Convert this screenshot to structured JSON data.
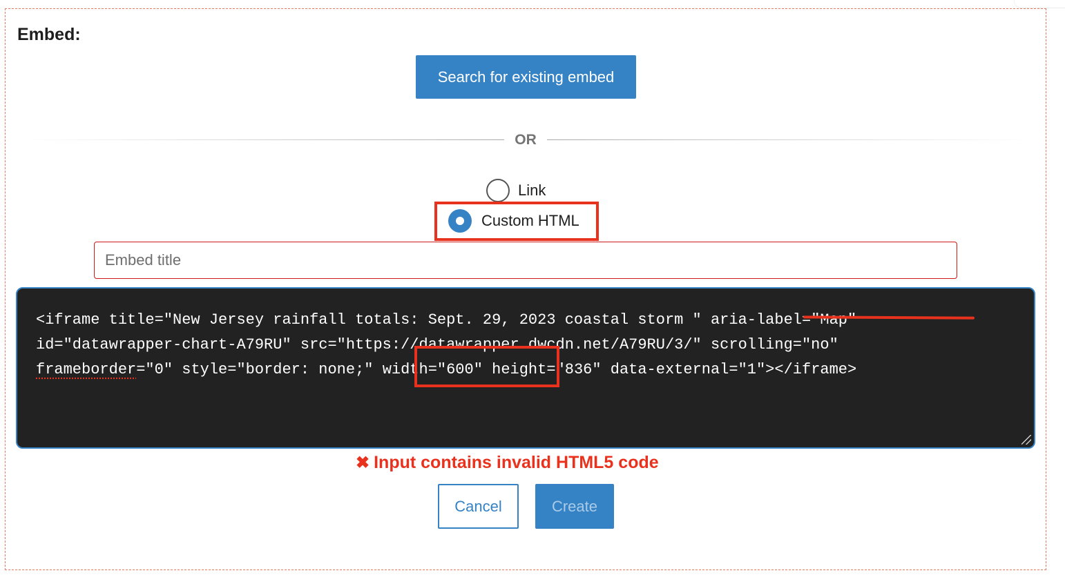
{
  "embed_section": {
    "label": "Embed:",
    "search_button_label": "Search for existing embed",
    "divider_text": "OR",
    "radio_options": [
      {
        "label": "Link",
        "selected": false
      },
      {
        "label": "Custom HTML",
        "selected": true
      }
    ],
    "title_input": {
      "value": "",
      "placeholder": "Embed title"
    },
    "code": {
      "line1_pre": "<iframe title=\"New Jersey rainfall totals: Sept. 29, 2023 coastal storm \" ",
      "line1_struck": "aria-label=\"Map\"",
      "line2": "id=\"datawrapper-chart-A79RU\" src=\"https://datawrapper.dwcdn.net/A79RU/3/\" scrolling=\"no\"",
      "line3_word": "frameborder",
      "line3_rest": "=\"0\" style=\"border: none;\" width=\"600\" height=\"836\" data-external=\"1\"></iframe>"
    },
    "error": {
      "icon": "✖",
      "message": "Input contains invalid HTML5 code"
    },
    "buttons": {
      "cancel_label": "Cancel",
      "create_label": "Create",
      "create_disabled": true
    }
  },
  "colors": {
    "accent": "#3582c4",
    "error": "#e8321e",
    "code_background": "#222222",
    "annotation": "#e8321e"
  }
}
